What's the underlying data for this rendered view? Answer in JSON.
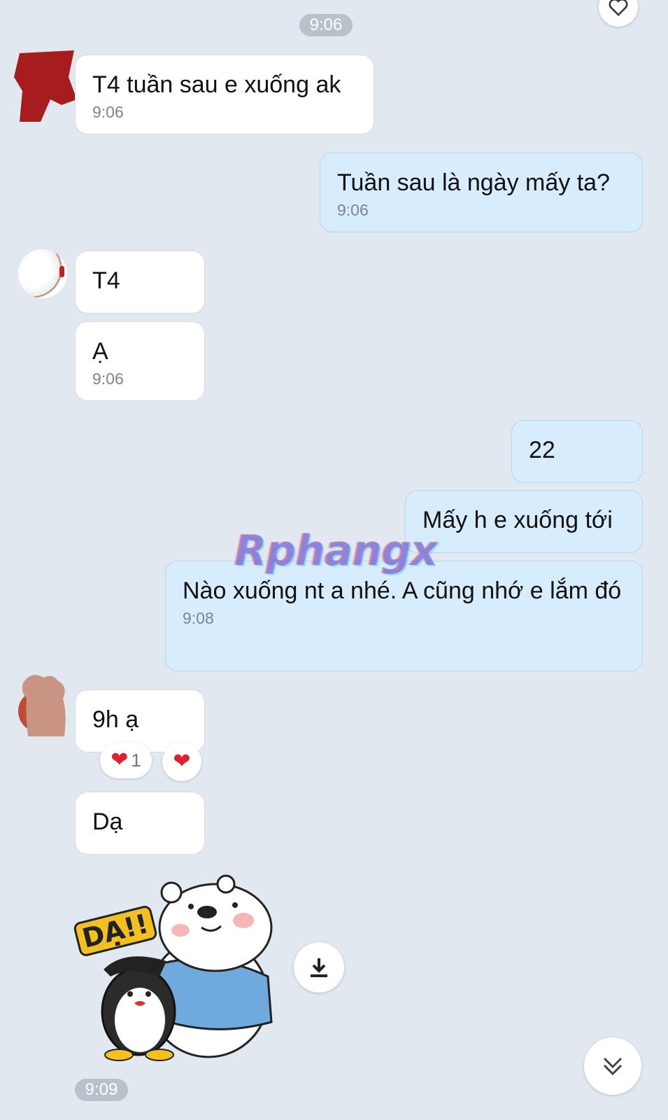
{
  "chat": {
    "top_time": "9:06",
    "messages": [
      {
        "text": "T4 tuần sau e xuống ak",
        "time": "9:06"
      },
      {
        "text": "Tuần sau là ngày mấy ta?",
        "time": "9:06"
      },
      {
        "text": "T4"
      },
      {
        "text": "Ạ",
        "time": "9:06"
      },
      {
        "text": "22"
      },
      {
        "text": "Mấy h e xuống tới"
      },
      {
        "text": "Nào xuống nt a nhé. A cũng nhớ e lắm đó",
        "time": "9:08"
      },
      {
        "text": "9h ạ"
      },
      {
        "text": "Dạ"
      }
    ],
    "reactions": {
      "count": "1"
    },
    "sticker": {
      "caption": "DẠ!!"
    },
    "sticker_time": "9:09"
  },
  "watermark": "Rphangx",
  "icons": {
    "top_right": "heart-outline-icon",
    "download": "download-icon",
    "scroll_down": "double-chevron-down-icon"
  },
  "colors": {
    "background": "#e2e8f0",
    "incoming_bubble": "#ffffff",
    "outgoing_bubble": "#d7ecfd",
    "reaction_heart": "#e0202f"
  }
}
